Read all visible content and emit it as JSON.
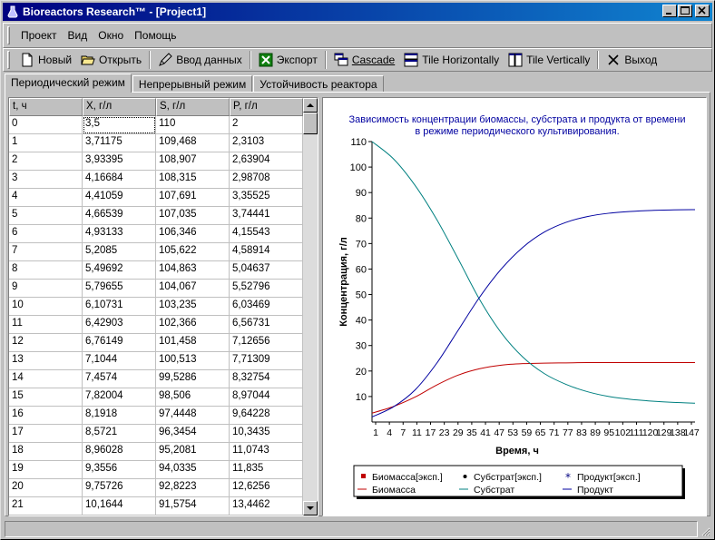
{
  "window": {
    "title": "Bioreactors Research™ - [Project1]",
    "controls": [
      "minimize",
      "maximize",
      "close"
    ]
  },
  "menu": {
    "items": [
      "Проект",
      "Вид",
      "Окно",
      "Помощь"
    ]
  },
  "toolbar": {
    "new_label": "Новый",
    "open_label": "Открыть",
    "input_label": "Ввод данных",
    "export_label": "Экспорт",
    "cascade_label": "Cascade",
    "tile_h_label": "Tile Horizontally",
    "tile_v_label": "Tile Vertically",
    "exit_label": "Выход"
  },
  "tabs": [
    {
      "label": "Периодический режим",
      "active": true
    },
    {
      "label": "Непрерывный режим",
      "active": false
    },
    {
      "label": "Устойчивость реактора",
      "active": false
    }
  ],
  "table": {
    "headers": [
      "t, ч",
      "X, г/л",
      "S, г/л",
      "P, г/л"
    ],
    "rows": [
      [
        "0",
        "3,5",
        "110",
        "2"
      ],
      [
        "1",
        "3,71175",
        "109,468",
        "2,3103"
      ],
      [
        "2",
        "3,93395",
        "108,907",
        "2,63904"
      ],
      [
        "3",
        "4,16684",
        "108,315",
        "2,98708"
      ],
      [
        "4",
        "4,41059",
        "107,691",
        "3,35525"
      ],
      [
        "5",
        "4,66539",
        "107,035",
        "3,74441"
      ],
      [
        "6",
        "4,93133",
        "106,346",
        "4,15543"
      ],
      [
        "7",
        "5,2085",
        "105,622",
        "4,58914"
      ],
      [
        "8",
        "5,49692",
        "104,863",
        "5,04637"
      ],
      [
        "9",
        "5,79655",
        "104,067",
        "5,52796"
      ],
      [
        "10",
        "6,10731",
        "103,235",
        "6,03469"
      ],
      [
        "11",
        "6,42903",
        "102,366",
        "6,56731"
      ],
      [
        "12",
        "6,76149",
        "101,458",
        "7,12656"
      ],
      [
        "13",
        "7,1044",
        "100,513",
        "7,71309"
      ],
      [
        "14",
        "7,4574",
        "99,5286",
        "8,32754"
      ],
      [
        "15",
        "7,82004",
        "98,506",
        "8,97044"
      ],
      [
        "16",
        "8,1918",
        "97,4448",
        "9,64228"
      ],
      [
        "17",
        "8,5721",
        "96,3454",
        "10,3435"
      ],
      [
        "18",
        "8,96028",
        "95,2081",
        "11,0743"
      ],
      [
        "19",
        "9,3556",
        "94,0335",
        "11,835"
      ],
      [
        "20",
        "9,75726",
        "92,8223",
        "12,6256"
      ],
      [
        "21",
        "10,1644",
        "91,5754",
        "13,4462"
      ]
    ]
  },
  "chart_data": {
    "type": "line",
    "title": "Зависимость концентрации биомассы, субстрата и продукта от времени в режиме периодического культивирования.",
    "title_line1": "Зависимость концентрации биомассы, субстрата и продукта от времени",
    "title_line2": "в режиме периодического культивирования.",
    "xlabel": "Время, ч",
    "ylabel": "Концентрация, г/л",
    "xlim": [
      0,
      150
    ],
    "ylim": [
      0,
      110
    ],
    "yticks": [
      10,
      20,
      30,
      40,
      50,
      60,
      70,
      80,
      90,
      100,
      110
    ],
    "xtick_labels": [
      "1",
      "4",
      "7",
      "11",
      "17",
      "23",
      "29",
      "35",
      "41",
      "47",
      "53",
      "59",
      "65",
      "71",
      "77",
      "83",
      "89",
      "95",
      "102",
      "111",
      "120",
      "129",
      "138",
      "147"
    ],
    "grid": false,
    "legend_placement": "bottom",
    "legend": [
      {
        "label": "Биомасса[эксп.]",
        "marker": "square",
        "color": "#c00000"
      },
      {
        "label": "Субстрат[эксп.]",
        "marker": "dot",
        "color": "#008080"
      },
      {
        "label": "Продукт[эксп.]",
        "marker": "star",
        "color": "#000080"
      },
      {
        "label": "Биомасса",
        "marker": "line",
        "color": "#c00000"
      },
      {
        "label": "Субстрат",
        "marker": "line",
        "color": "#008080"
      },
      {
        "label": "Продукт",
        "marker": "line",
        "color": "#0000a0"
      }
    ],
    "x": [
      0,
      10,
      20,
      30,
      40,
      50,
      60,
      70,
      80,
      90,
      100,
      110,
      120,
      130,
      140,
      150
    ],
    "series": [
      {
        "name": "Биомасса",
        "color": "#c00000",
        "values": [
          3.5,
          6.1,
          9.8,
          14.5,
          18.4,
          20.9,
          22.3,
          22.9,
          23.1,
          23.2,
          23.3,
          23.3,
          23.3,
          23.3,
          23.3,
          23.3
        ]
      },
      {
        "name": "Субстрат",
        "color": "#008080",
        "values": [
          110,
          103.2,
          92.8,
          79.5,
          64.0,
          48.0,
          35.0,
          25.5,
          19.0,
          14.8,
          11.9,
          10.0,
          8.9,
          8.2,
          7.7,
          7.4
        ]
      },
      {
        "name": "Продукт",
        "color": "#0000a0",
        "values": [
          2,
          6.0,
          12.6,
          23.0,
          36.0,
          49.0,
          60.0,
          68.5,
          74.5,
          78.3,
          80.6,
          81.9,
          82.6,
          83.0,
          83.2,
          83.3
        ]
      }
    ]
  },
  "colors": {
    "titlebar_start": "#000080",
    "titlebar_end": "#1084d0",
    "face": "#c0c0c0",
    "chart_title": "#0000a0"
  }
}
